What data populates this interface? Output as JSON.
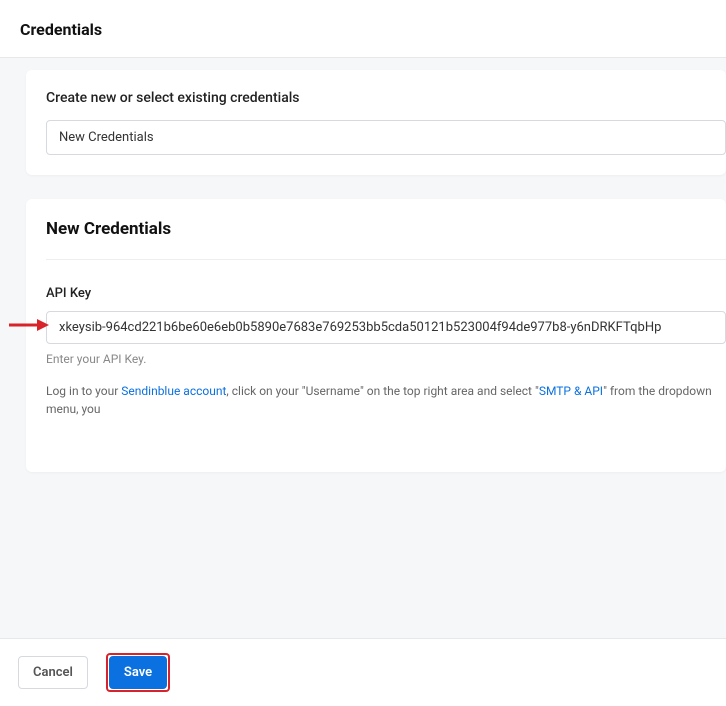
{
  "header": {
    "title": "Credentials"
  },
  "selectCard": {
    "label": "Create new or select existing credentials",
    "selectedValue": "New Credentials"
  },
  "formCard": {
    "title": "New Credentials",
    "apiKey": {
      "label": "API Key",
      "value": "xkeysib-964cd221b6be60e6eb0b5890e7683e769253bb5cda50121b523004f94de977b8-y6nDRKFTqbHp",
      "help": "Enter your API Key.",
      "infoPrefix": "Log in to your ",
      "link1": "Sendinblue account",
      "infoMid": ", click on your \"Username\" on the top right area and select \"",
      "link2": "SMTP & API",
      "infoSuffix": "\" from the dropdown menu, you"
    }
  },
  "footer": {
    "cancel": "Cancel",
    "save": "Save"
  }
}
